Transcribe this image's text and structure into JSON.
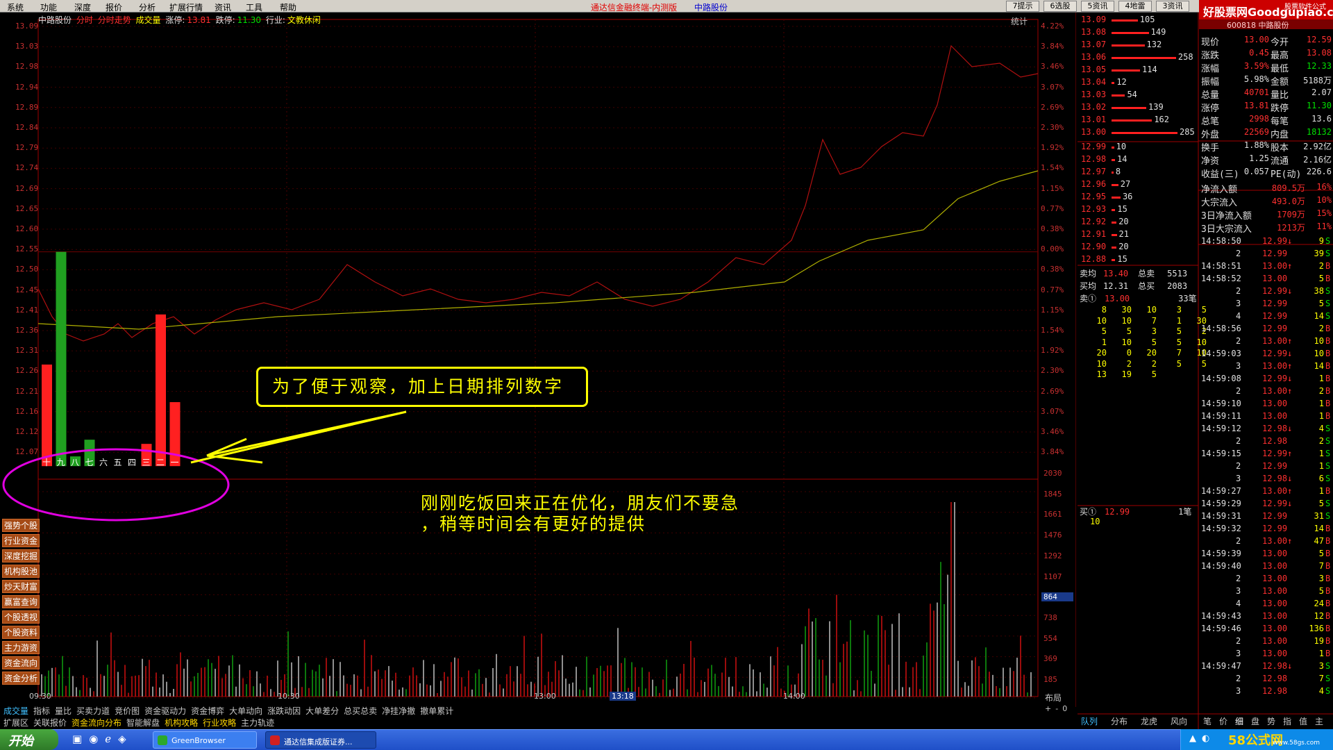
{
  "menu": {
    "items": [
      "系统",
      "功能",
      "深度",
      "报价",
      "分析",
      "扩展行情",
      "资讯",
      "工具",
      "帮助"
    ],
    "app_title": "通达信金融终端-内测版",
    "stock_name": "中路股份",
    "buttons": [
      "7提示",
      "6选股",
      "5资讯",
      "4地雷",
      "3资讯"
    ],
    "software_label": "股票软件公式"
  },
  "logo": {
    "text": "好股票网Goodgupiao.com",
    "code_line": "600818 中路股份"
  },
  "chart": {
    "info": {
      "name": "中路股份",
      "tag_fs": "分时",
      "tag_fscj": "分时走势",
      "tag_cjl": "成交量",
      "limit_up_label": "涨停:",
      "limit_up": "13.81",
      "limit_down_label": "跌停:",
      "limit_down": "11.30",
      "industry_label": "行业:",
      "industry": "文教休闲"
    },
    "tongji": "统计",
    "price_labels": [
      "13.09",
      "13.03",
      "12.98",
      "12.94",
      "12.89",
      "12.84",
      "12.79",
      "12.74",
      "12.69",
      "12.65",
      "12.60",
      "12.55",
      "12.50",
      "12.45",
      "12.41",
      "12.36",
      "12.31",
      "12.26",
      "12.21",
      "12.16",
      "12.12",
      "12.07"
    ],
    "pct_labels": [
      "4.22%",
      "3.84%",
      "3.46%",
      "3.07%",
      "2.69%",
      "2.30%",
      "1.92%",
      "1.54%",
      "1.15%",
      "0.77%",
      "0.38%",
      "0.00%",
      "0.38%",
      "0.77%",
      "1.15%",
      "1.54%",
      "1.92%",
      "2.30%",
      "2.69%",
      "3.07%",
      "3.46%",
      "3.84%"
    ],
    "vol_labels": [
      "2030",
      "1845",
      "1661",
      "1476",
      "1292",
      "1107",
      "864",
      "738",
      "554",
      "369",
      "185"
    ],
    "vol_highlight": "864",
    "time_labels": [
      "09:30",
      "10:30",
      "13:00",
      "13:18",
      "14:00"
    ],
    "layout_label": "布局",
    "layout_controls": [
      "+",
      "-",
      "0"
    ],
    "day_bars": [
      {
        "label": "十",
        "color": "#ff2020",
        "value": 12.28
      },
      {
        "label": "九",
        "color": "#20a020",
        "value": 12.55
      },
      {
        "label": "八",
        "color": "#20a020",
        "value": 12.06
      },
      {
        "label": "七",
        "color": "#20a020",
        "value": 12.1
      },
      {
        "label": "六",
        "color": "",
        "value": null
      },
      {
        "label": "五",
        "color": "",
        "value": null
      },
      {
        "label": "四",
        "color": "",
        "value": null
      },
      {
        "label": "三",
        "color": "#ff2020",
        "value": 12.09
      },
      {
        "label": "二",
        "color": "#ff2020",
        "value": 12.4
      },
      {
        "label": "一",
        "color": "#ff2020",
        "value": 12.19
      }
    ]
  },
  "callout": {
    "text": "为了便于观察，加上日期排列数字"
  },
  "note": {
    "text": "刚刚吃饭回来正在优化，朋友们不要急\n，稍等时间会有更好的提供"
  },
  "sidebar_buttons": [
    "强势个股",
    "行业资金",
    "深度挖掘",
    "机构股池",
    "炒天财富",
    "赢富查询",
    "个股透视",
    "个股资料",
    "主力游资",
    "资金流向",
    "资金分析"
  ],
  "bottom_tabs_1": [
    "成交量",
    "指标",
    "量比",
    "买卖力道",
    "竞价图",
    "资金驱动力",
    "资金博弈",
    "大单动向",
    "涨跌动因",
    "大单差分",
    "总买总卖",
    "净挂净撤",
    "撤单累计"
  ],
  "bottom_tabs_2": [
    "扩展区",
    "关联报价",
    "资金流向分布",
    "智能解盘",
    "机构攻略",
    "行业攻略",
    "主力轨迹"
  ],
  "bottom_tabs_2_on": [
    "资金流向分布",
    "机构攻略",
    "行业攻略"
  ],
  "order_book": {
    "sells": [
      {
        "p": "13.09",
        "v": "105"
      },
      {
        "p": "13.08",
        "v": "149"
      },
      {
        "p": "13.07",
        "v": "132"
      },
      {
        "p": "13.06",
        "v": "258"
      },
      {
        "p": "13.05",
        "v": "114"
      },
      {
        "p": "13.04",
        "v": "12"
      },
      {
        "p": "13.03",
        "v": "54"
      },
      {
        "p": "13.02",
        "v": "139"
      },
      {
        "p": "13.01",
        "v": "162"
      },
      {
        "p": "13.00",
        "v": "285"
      }
    ],
    "buys": [
      {
        "p": "12.99",
        "v": "10"
      },
      {
        "p": "12.98",
        "v": "14"
      },
      {
        "p": "12.97",
        "v": "8"
      },
      {
        "p": "12.96",
        "v": "27"
      },
      {
        "p": "12.95",
        "v": "36"
      },
      {
        "p": "12.93",
        "v": "15"
      },
      {
        "p": "12.92",
        "v": "20"
      },
      {
        "p": "12.91",
        "v": "21"
      },
      {
        "p": "12.90",
        "v": "20"
      },
      {
        "p": "12.88",
        "v": "15"
      }
    ],
    "avg": [
      {
        "l1": "卖均",
        "v1": "13.40",
        "l2": "总卖",
        "v2": "5513"
      },
      {
        "l1": "买均",
        "v1": "12.31",
        "l2": "总买",
        "v2": "2083"
      }
    ],
    "sell1": {
      "label": "卖①",
      "price": "13.00",
      "count": "33笔"
    },
    "sell1_queue": [
      [
        "8",
        "30",
        "10",
        "3",
        "5"
      ],
      [
        "10",
        "10",
        "7",
        "1",
        "30"
      ],
      [
        "5",
        "5",
        "3",
        "5",
        "2"
      ],
      [
        "1",
        "10",
        "5",
        "5",
        "10"
      ],
      [
        "20",
        "0",
        "20",
        "7",
        "10"
      ],
      [
        "10",
        "2",
        "2",
        "5",
        "5"
      ],
      [
        "13",
        "19",
        "5",
        "",
        ""
      ]
    ],
    "buy1": {
      "label": "买①",
      "price": "12.99",
      "count": "1笔",
      "queue": "10"
    }
  },
  "quote": {
    "rows": [
      [
        "现价",
        "13.00",
        "今开",
        "12.59"
      ],
      [
        "涨跌",
        "0.45",
        "最高",
        "13.08"
      ],
      [
        "涨幅",
        "3.59%",
        "最低",
        "12.33"
      ],
      [
        "振幅",
        "5.98%",
        "金额",
        "5188万"
      ],
      [
        "总量",
        "40701",
        "量比",
        "2.07"
      ],
      [
        "涨停",
        "13.81",
        "跌停",
        "11.30"
      ],
      [
        "总笔",
        "2998",
        "每笔",
        "13.6"
      ],
      [
        "外盘",
        "22569",
        "内盘",
        "18132"
      ],
      [
        "换手",
        "1.88%",
        "股本",
        "2.92亿"
      ],
      [
        "净资",
        "1.25",
        "流通",
        "2.16亿"
      ],
      [
        "收益(三)",
        "0.057",
        "PE(动)",
        "226.6"
      ]
    ],
    "flows": [
      [
        "净流入额",
        "809.5万",
        "16%"
      ],
      [
        "大宗流入",
        "493.0万",
        "10%"
      ],
      [
        "3日净流入额",
        "1709万",
        "15%"
      ],
      [
        "3日大宗流入",
        "1213万",
        "11%"
      ]
    ]
  },
  "ticks": [
    [
      "14:58:50",
      "12.99↓",
      "9",
      "S"
    ],
    [
      "2",
      "12.99",
      "39",
      "S"
    ],
    [
      "14:58:51",
      "13.00↑",
      "2",
      "B"
    ],
    [
      "14:58:52",
      "13.00",
      "5",
      "B"
    ],
    [
      "2",
      "12.99↓",
      "38",
      "S"
    ],
    [
      "3",
      "12.99",
      "5",
      "S"
    ],
    [
      "4",
      "12.99",
      "14",
      "S"
    ],
    [
      "14:58:56",
      "12.99",
      "2",
      "B"
    ],
    [
      "2",
      "13.00↑",
      "10",
      "B"
    ],
    [
      "14:59:03",
      "12.99↓",
      "10",
      "B"
    ],
    [
      "3",
      "13.00↑",
      "14",
      "B"
    ],
    [
      "14:59:08",
      "12.99↓",
      "1",
      "B"
    ],
    [
      "2",
      "13.00↑",
      "2",
      "B"
    ],
    [
      "14:59:10",
      "13.00",
      "1",
      "B"
    ],
    [
      "14:59:11",
      "13.00",
      "1",
      "B"
    ],
    [
      "14:59:12",
      "12.98↓",
      "4",
      "S"
    ],
    [
      "2",
      "12.98",
      "2",
      "S"
    ],
    [
      "14:59:15",
      "12.99↑",
      "1",
      "S"
    ],
    [
      "2",
      "12.99",
      "1",
      "S"
    ],
    [
      "3",
      "12.98↓",
      "6",
      "S"
    ],
    [
      "14:59:27",
      "13.00↑",
      "1",
      "B"
    ],
    [
      "14:59:29",
      "12.99↓",
      "5",
      "S"
    ],
    [
      "14:59:31",
      "12.99",
      "31",
      "S"
    ],
    [
      "14:59:32",
      "12.99",
      "14",
      "B"
    ],
    [
      "2",
      "13.00↑",
      "47",
      "B"
    ],
    [
      "14:59:39",
      "13.00",
      "5",
      "B"
    ],
    [
      "14:59:40",
      "13.00",
      "7",
      "B"
    ],
    [
      "2",
      "13.00",
      "3",
      "B"
    ],
    [
      "3",
      "13.00",
      "5",
      "B"
    ],
    [
      "4",
      "13.00",
      "24",
      "B"
    ],
    [
      "14:59:43",
      "13.00",
      "12",
      "B"
    ],
    [
      "14:59:46",
      "13.00",
      "136",
      "B"
    ],
    [
      "2",
      "13.00",
      "19",
      "B"
    ],
    [
      "3",
      "13.00",
      "1",
      "B"
    ],
    [
      "14:59:47",
      "12.98↓",
      "3",
      "S"
    ],
    [
      "2",
      "12.98",
      "7",
      "S"
    ],
    [
      "3",
      "12.98",
      "4",
      "S"
    ]
  ],
  "right_tabs": [
    "队列",
    "分布",
    "龙虎",
    "风向"
  ],
  "right_tabs2": [
    "笔",
    "价",
    "细",
    "盘",
    "势",
    "指",
    "值",
    "主"
  ],
  "taskbar": {
    "start": "开始",
    "tasks": [
      "GreenBrowser",
      "通达信集成版证券..."
    ],
    "tray_text": "58公式网",
    "tray_url": "www.58gs.com"
  }
}
